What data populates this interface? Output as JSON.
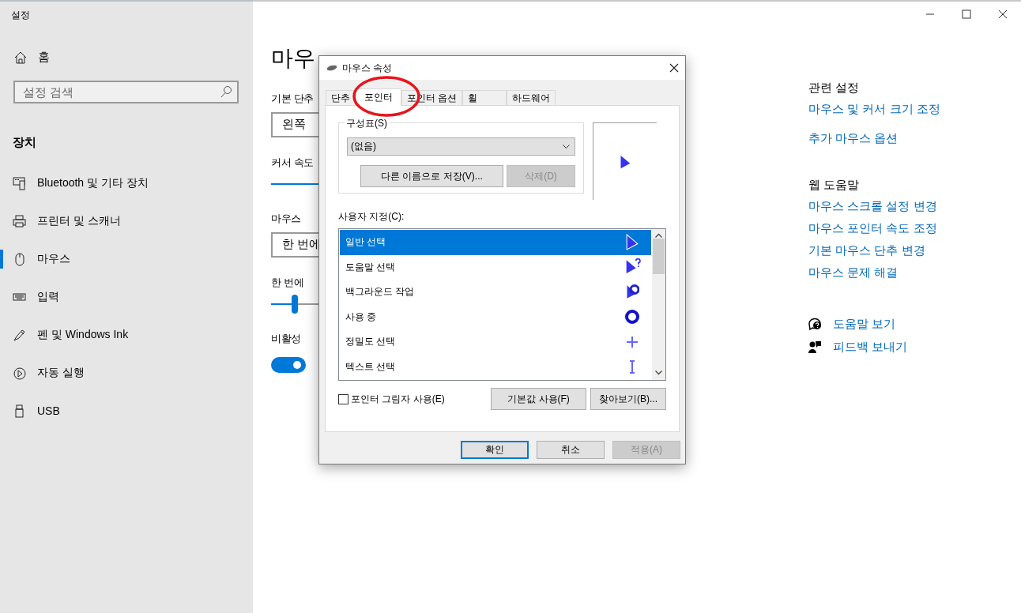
{
  "window": {
    "title": "설정"
  },
  "sidebar": {
    "home": "홈",
    "search": {
      "placeholder": "설정 검색"
    },
    "section": "장치",
    "items": [
      {
        "label": "Bluetooth 및 기타 장치",
        "selected": false
      },
      {
        "label": "프린터 및 스캐너",
        "selected": false
      },
      {
        "label": "마우스",
        "selected": true
      },
      {
        "label": "입력",
        "selected": false
      },
      {
        "label": "펜 및 Windows Ink",
        "selected": false
      },
      {
        "label": "자동 실행",
        "selected": false
      },
      {
        "label": "USB",
        "selected": false
      }
    ]
  },
  "main": {
    "title": "마우",
    "settings": [
      {
        "kind": "dropdown",
        "label": "기본 단추",
        "value": "왼쪽"
      },
      {
        "kind": "slider",
        "label": "커서 속도"
      },
      {
        "kind": "dropdown",
        "label": "마우스",
        "value": "한 번에"
      },
      {
        "kind": "slider",
        "label": "한 번에",
        "level": 0.1
      },
      {
        "kind": "toggle",
        "label": "비활성",
        "on": true
      }
    ]
  },
  "related": {
    "heading": "관련 설정",
    "links": [
      "마우스 및 커서 크기 조정",
      "추가 마우스 옵션"
    ]
  },
  "web_help": {
    "heading": "웹 도움말",
    "links": [
      "마우스 스크롤 설정 변경",
      "마우스 포인터 속도 조정",
      "기본 마우스 단추 변경",
      "마우스 문제 해결"
    ]
  },
  "help_actions": [
    "도움말 보기",
    "피드백 보내기"
  ],
  "dialog": {
    "title": "마우스 속성",
    "tabs": [
      {
        "label": "단추",
        "selected": false
      },
      {
        "label": "포인터",
        "selected": true
      },
      {
        "label": "포인터 옵션",
        "selected": false
      },
      {
        "label": "휠",
        "selected": false
      },
      {
        "label": "하드웨어",
        "selected": false
      }
    ],
    "scheme": {
      "label": "구성표(S)",
      "value": "(없음)",
      "save_button": "다른 이름으로 저장(V)...",
      "delete_button": {
        "label": "삭제(D)",
        "disabled": true
      }
    },
    "customize_label": "사용자 지정(C):",
    "pointers": [
      {
        "label": "일반 선택",
        "selected": true
      },
      {
        "label": "도움말 선택",
        "selected": false
      },
      {
        "label": "백그라운드 작업",
        "selected": false
      },
      {
        "label": "사용 중",
        "selected": false
      },
      {
        "label": "정밀도 선택",
        "selected": false
      },
      {
        "label": "텍스트 선택",
        "selected": false
      }
    ],
    "shadow": {
      "label": "포인터 그림자 사용(E)",
      "checked": false
    },
    "default_button": "기본값 사용(F)",
    "browse_button": "찾아보기(B)...",
    "footer": [
      {
        "label": "확인",
        "default": true,
        "disabled": false
      },
      {
        "label": "취소",
        "default": false,
        "disabled": false
      },
      {
        "label": "적용(A)",
        "default": false,
        "disabled": true
      }
    ]
  }
}
